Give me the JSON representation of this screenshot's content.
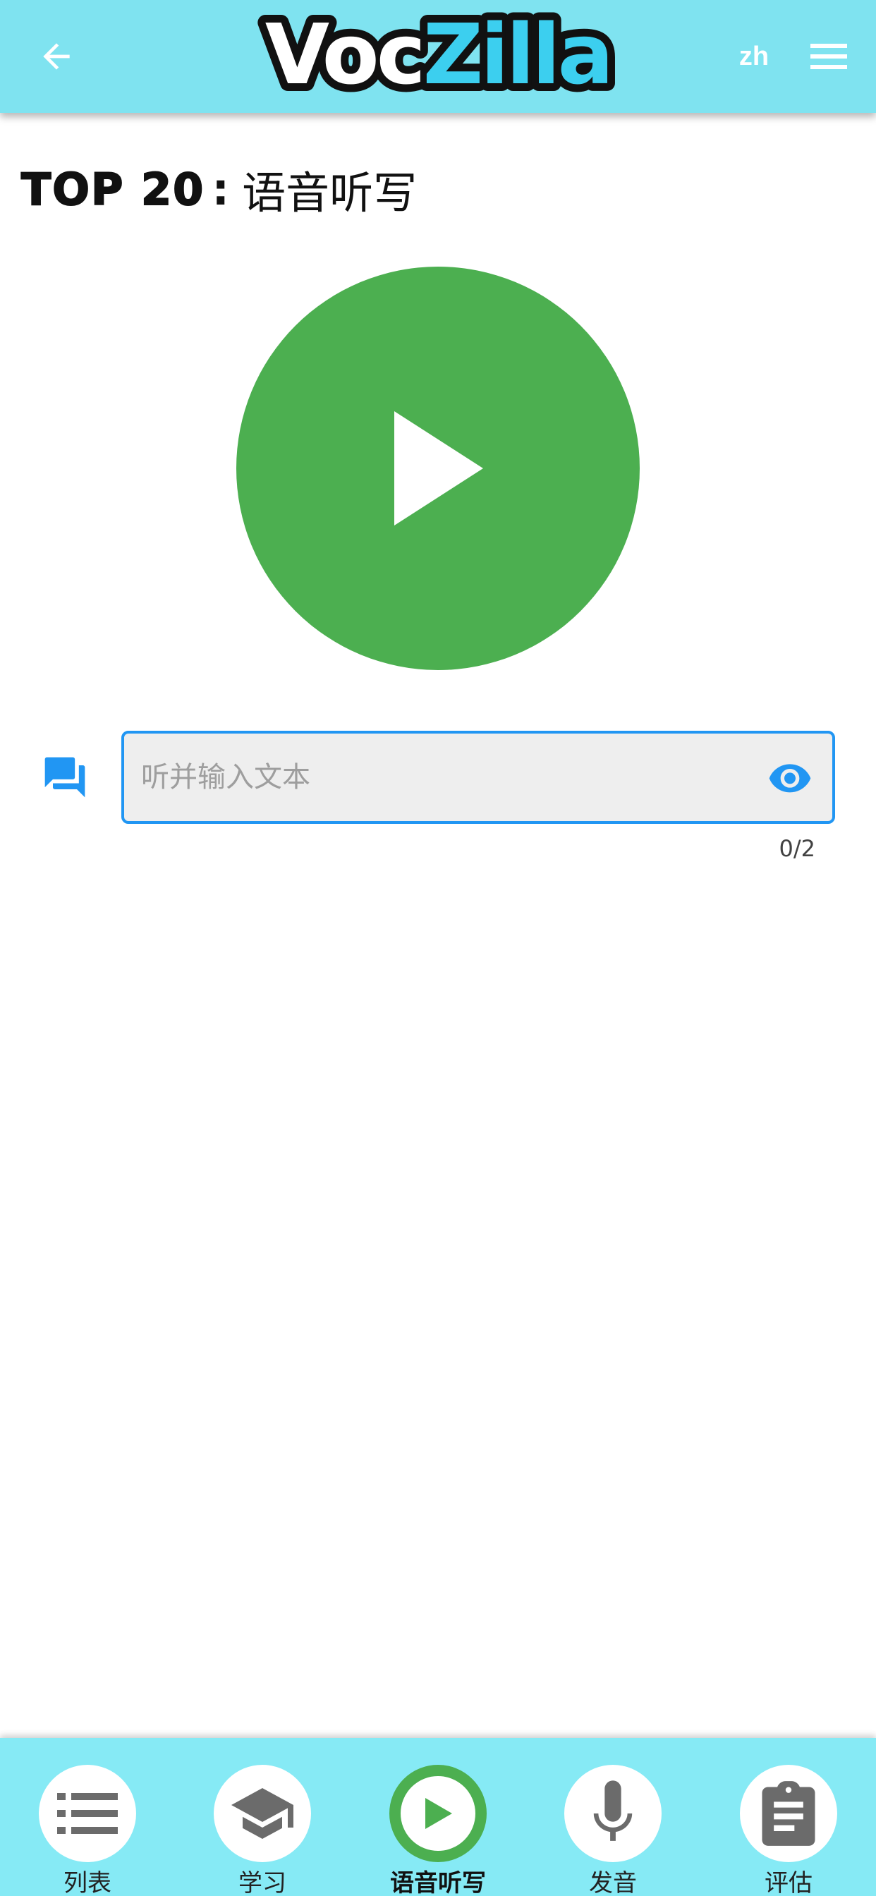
{
  "app": {
    "logo_part1": "Voc",
    "logo_part2": "Zilla",
    "language": "zh"
  },
  "colors": {
    "appbar": "#7fe3f0",
    "accent_green": "#4caf50",
    "accent_blue": "#2196f3",
    "logo_blue": "#3ccfef",
    "bottom_nav": "#86eaf5"
  },
  "page": {
    "title_prefix": "TOP 20",
    "title_separator": ":",
    "title_main": "语音听写"
  },
  "dictation": {
    "input_placeholder": "听并输入文本",
    "input_value": "",
    "counter": "0/2"
  },
  "icons": {
    "back": "arrow-left-icon",
    "menu": "hamburger-menu-icon",
    "play": "play-icon",
    "chat": "chat-bubbles-icon",
    "reveal": "eye-icon"
  },
  "bottom_nav": {
    "items": [
      {
        "label": "列表",
        "icon": "list-icon",
        "active": false
      },
      {
        "label": "学习",
        "icon": "graduation-cap-icon",
        "active": false
      },
      {
        "label": "语音听写",
        "icon": "play-circle-icon",
        "active": true
      },
      {
        "label": "发音",
        "icon": "microphone-icon",
        "active": false
      },
      {
        "label": "评估",
        "icon": "clipboard-icon",
        "active": false
      }
    ]
  }
}
